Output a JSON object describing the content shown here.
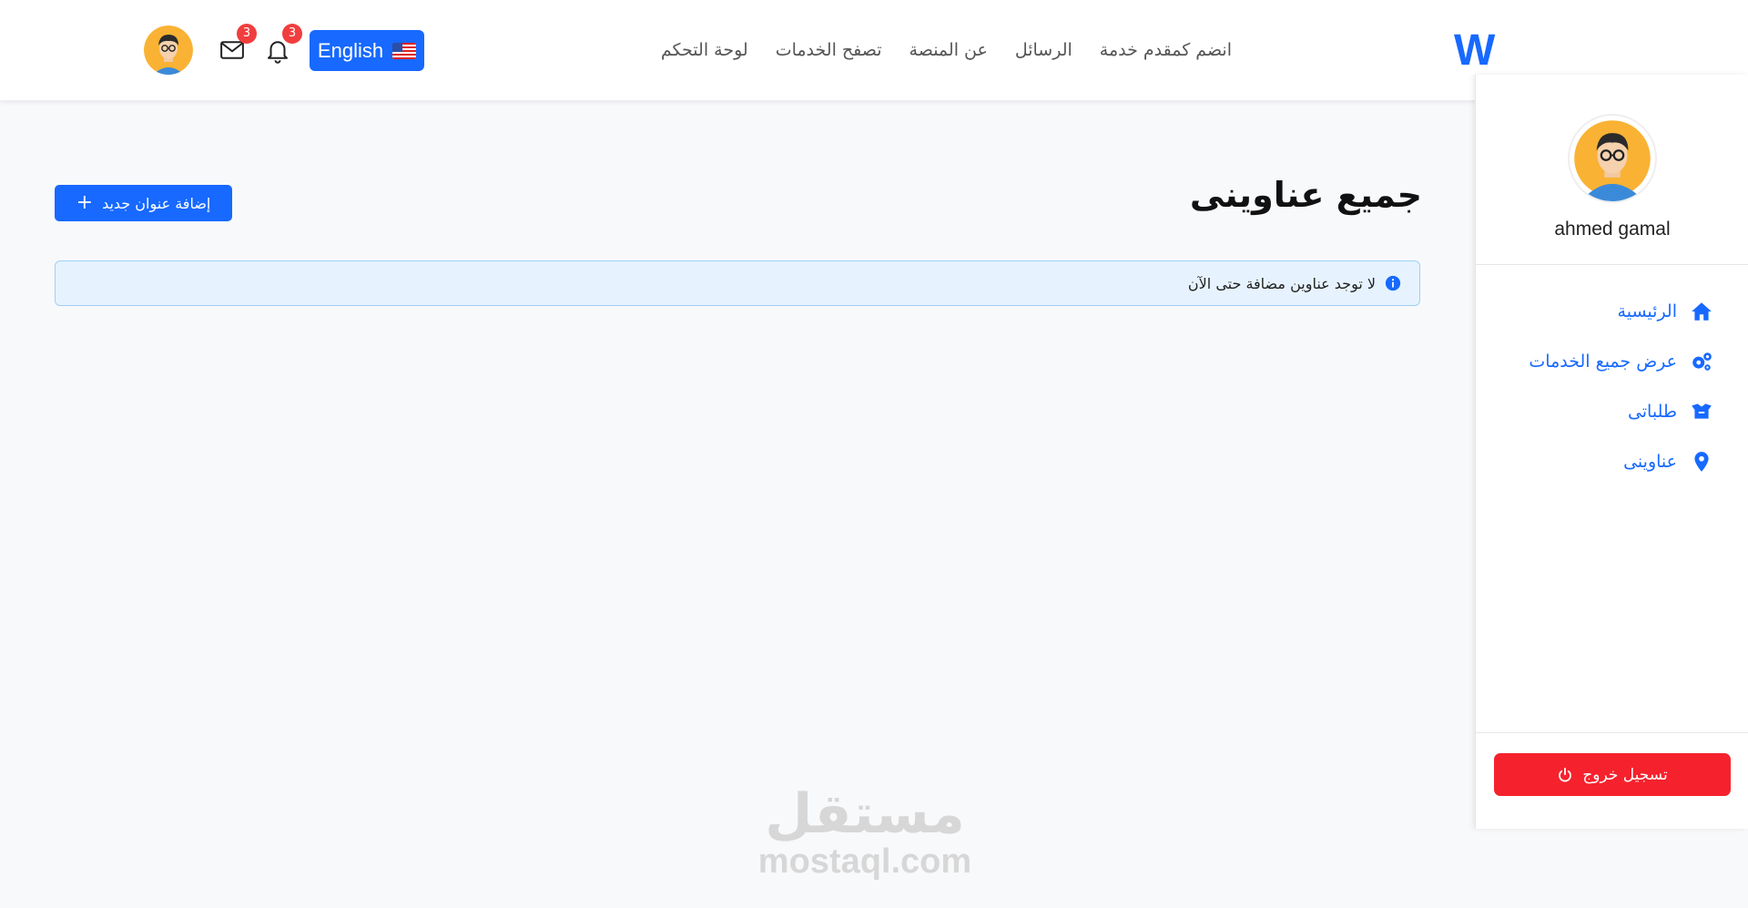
{
  "header": {
    "logo_text": "W",
    "language_label": "English",
    "notifications_count": "3",
    "messages_count": "3",
    "nav": [
      {
        "label": "لوحة التحكم"
      },
      {
        "label": "تصفح الخدمات"
      },
      {
        "label": "عن المنصة"
      },
      {
        "label": "الرسائل"
      },
      {
        "label": "انضم كمقدم خدمة"
      }
    ]
  },
  "main": {
    "title": "جميع عناوينى",
    "add_button_label": "إضافة عنوان جديد",
    "empty_alert": "لا توجد عناوين مضافة حتى الآن"
  },
  "sidebar": {
    "user_name": "ahmed gamal",
    "items": [
      {
        "label": "الرئيسية",
        "icon": "home-icon"
      },
      {
        "label": "عرض جميع الخدمات",
        "icon": "gears-icon"
      },
      {
        "label": "طلباتى",
        "icon": "box-icon"
      },
      {
        "label": "عناوينى",
        "icon": "map-pin-icon"
      }
    ],
    "logout_label": "تسجيل خروج"
  },
  "watermark": {
    "arabic": "مستقل",
    "latin": "mostaql.com"
  },
  "colors": {
    "primary": "#1769ff",
    "danger": "#f5222d",
    "badge": "#f03e3e",
    "alert_bg": "#e6f3ff"
  }
}
